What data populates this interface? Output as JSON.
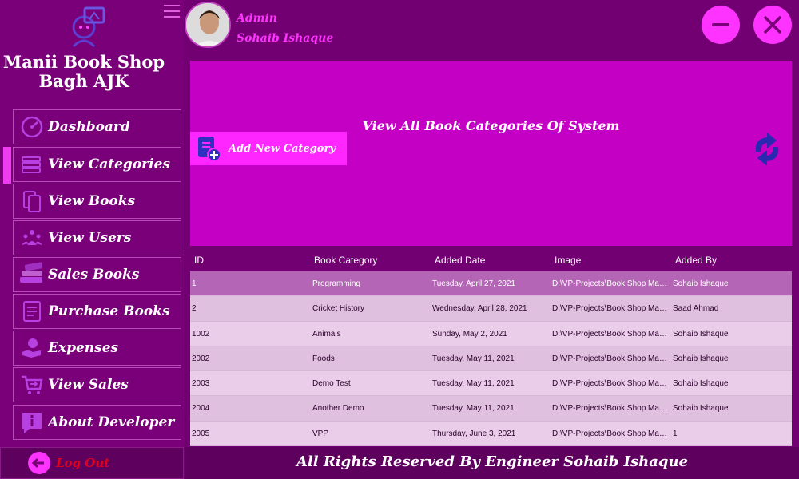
{
  "app": {
    "shop_name_line1": "Manii Book Shop",
    "shop_name_line2": "Bagh AJK"
  },
  "user": {
    "role": "Admin",
    "name": "Sohaib Ishaque"
  },
  "sidebar": {
    "items": [
      {
        "label": "Dashboard",
        "icon": "dashboard-gauge-icon"
      },
      {
        "label": "View Categories",
        "icon": "categories-icon",
        "active": true
      },
      {
        "label": "View Books",
        "icon": "books-icon"
      },
      {
        "label": "View Users",
        "icon": "users-icon"
      },
      {
        "label": "Sales Books",
        "icon": "book-stack-icon"
      },
      {
        "label": "Purchase Books",
        "icon": "receipt-icon"
      },
      {
        "label": "Expenses",
        "icon": "hand-money-icon"
      },
      {
        "label": "View Sales",
        "icon": "cart-icon"
      },
      {
        "label": "About Developer",
        "icon": "info-icon"
      }
    ],
    "logout_label": "Log Out"
  },
  "banner": {
    "title": "View All Book Categories Of System",
    "add_button_label": "Add New Category"
  },
  "table": {
    "headers": [
      "ID",
      "Book Category",
      "Added Date",
      "Image",
      "Added By"
    ],
    "rows": [
      {
        "id": "1",
        "category": "Programming",
        "date": "Tuesday, April 27, 2021",
        "image": "D:\\VP-Projects\\Book Shop Man...",
        "by": "Sohaib Ishaque"
      },
      {
        "id": "2",
        "category": "Cricket History",
        "date": "Wednesday, April 28, 2021",
        "image": "D:\\VP-Projects\\Book Shop Man...",
        "by": "Saad Ahmad"
      },
      {
        "id": "1002",
        "category": "Animals",
        "date": "Sunday, May 2, 2021",
        "image": "D:\\VP-Projects\\Book Shop Man...",
        "by": "Sohaib Ishaque"
      },
      {
        "id": "2002",
        "category": "Foods",
        "date": "Tuesday, May 11, 2021",
        "image": "D:\\VP-Projects\\Book Shop Man...",
        "by": "Sohaib Ishaque"
      },
      {
        "id": "2003",
        "category": "Demo Test",
        "date": "Tuesday, May 11, 2021",
        "image": "D:\\VP-Projects\\Book Shop Man...",
        "by": "Sohaib Ishaque"
      },
      {
        "id": "2004",
        "category": "Another Demo",
        "date": "Tuesday, May 11, 2021",
        "image": "D:\\VP-Projects\\Book Shop Man...",
        "by": "Sohaib Ishaque"
      },
      {
        "id": "2005",
        "category": "VPP",
        "date": "Thursday, June 3, 2021",
        "image": "D:\\VP-Projects\\Book Shop Man...",
        "by": "1"
      }
    ]
  },
  "footer": {
    "text": "All Rights Reserved By Engineer Sohaib Ishaque"
  },
  "colors": {
    "background": "#730073",
    "banner": "#c300c3",
    "accent": "#ff33ff",
    "selected_row": "#b565b5"
  }
}
